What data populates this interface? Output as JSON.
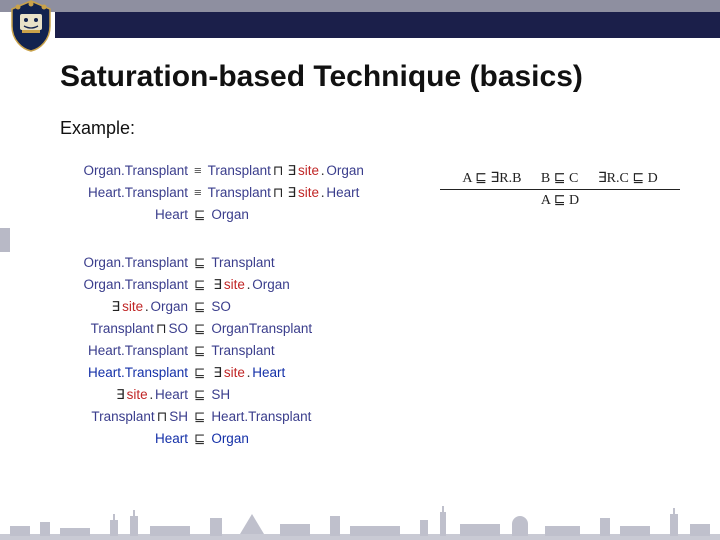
{
  "header": {
    "title": "Saturation-based Technique (basics)",
    "subtitle": "Example:"
  },
  "colors": {
    "accent_bar": "#1b1f4a",
    "muted_bar": "#8e8fa0",
    "concept": "#3a3d8c",
    "role": "#c02626"
  },
  "ontology_axioms": [
    {
      "lhs": "Organ.Transplant",
      "rel": "≡",
      "rhs_html": "<span class='concept'>Transplant</span><span class='sym'>⊓</span><span class='sym'>∃</span><span class='role'>site</span><span class='sym'>.</span><span class='concept'>Organ</span>"
    },
    {
      "lhs": "Heart.Transplant",
      "rel": "≡",
      "rhs_html": "<span class='concept'>Transplant</span><span class='sym'>⊓</span><span class='sym'>∃</span><span class='role'>site</span><span class='sym'>.</span><span class='concept'>Heart</span>"
    },
    {
      "lhs": "Heart",
      "rel": "⊑",
      "rhs_html": "<span class='concept'>Organ</span>"
    }
  ],
  "inference_rule": {
    "premises": [
      "A ⊑ ∃R.B",
      "B ⊑ C",
      "∃R.C ⊑ D"
    ],
    "conclusion": "A ⊑ D"
  },
  "derived_axioms": [
    {
      "lhs_html": "<span class='concept'>Organ.Transplant</span>",
      "rel": "⊑",
      "rhs_html": "<span class='concept'>Transplant</span>"
    },
    {
      "lhs_html": "<span class='concept'>Organ.Transplant</span>",
      "rel": "⊑",
      "rhs_html": "<span class='sym'>∃</span><span class='role'>site</span><span class='sym'>.</span><span class='concept'>Organ</span>"
    },
    {
      "lhs_html": "<span class='sym'>∃</span><span class='role'>site</span><span class='sym'>.</span><span class='concept'>Organ</span>",
      "rel": "⊑",
      "rhs_html": "<span class='concept'>SO</span>"
    },
    {
      "lhs_html": "<span class='concept'>Transplant</span><span class='sym'>⊓</span><span class='concept'>SO</span>",
      "rel": "⊑",
      "rhs_html": "<span class='concept'>OrganTransplant</span>"
    },
    {
      "lhs_html": "<span class='concept'>Heart.Transplant</span>",
      "rel": "⊑",
      "rhs_html": "<span class='concept'>Transplant</span>"
    },
    {
      "lhs_html": "<span class='concept'>Heart.Transplant</span>",
      "rel": "⊑",
      "rhs_html": "<span class='sym'>∃</span><span class='role'>site</span><span class='sym'>.</span><span class='concept'>Heart</span>",
      "highlight": true
    },
    {
      "lhs_html": "<span class='sym'>∃</span><span class='role'>site</span><span class='sym'>.</span><span class='concept'>Heart</span>",
      "rel": "⊑",
      "rhs_html": "<span class='concept'>SH</span>"
    },
    {
      "lhs_html": "<span class='concept'>Transplant</span><span class='sym'>⊓</span><span class='concept'>SH</span>",
      "rel": "⊑",
      "rhs_html": "<span class='concept'>Heart.Transplant</span>"
    },
    {
      "lhs_html": "<span class='concept'>Heart</span>",
      "rel": "⊑",
      "rhs_html": "<span class='concept'>Organ</span>",
      "highlight": true
    }
  ],
  "chart_data": null
}
